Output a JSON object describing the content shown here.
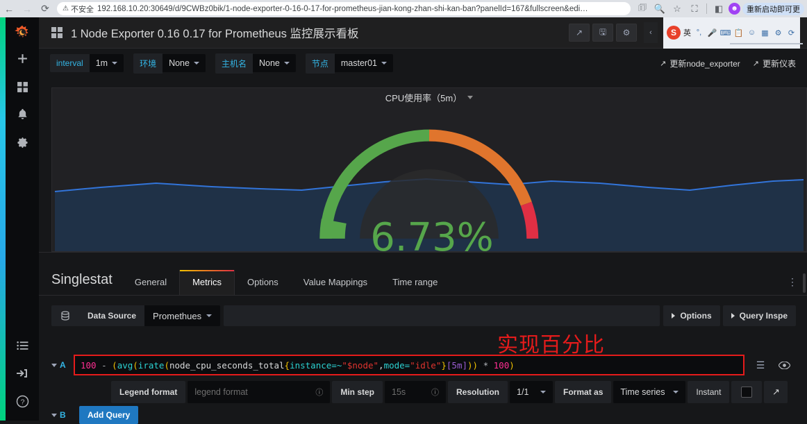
{
  "browser": {
    "back_icon": "←",
    "forward_icon": "→",
    "reload_icon": "⟳",
    "security_label": "不安全",
    "warning_icon": "⚠",
    "url": "192.168.10.20:30649/d/9CWBz0bik/1-node-exporter-0-16-0-17-for-prometheus-jian-kong-zhan-shi-kan-ban?panelId=167&fullscreen&edi…",
    "toolbar_icons": [
      "translate-icon",
      "zoom-icon",
      "bookmark-star-icon",
      "extensions-icon",
      "split-view-icon"
    ],
    "profile_initial": "👤",
    "restart_pill": "重新启动即可更"
  },
  "sidenav": {
    "logo": "grafana-logo",
    "items": [
      {
        "name": "create-add",
        "icon": "+"
      },
      {
        "name": "dashboards",
        "icon": "▦"
      },
      {
        "name": "alerting-bell",
        "icon": "🔔"
      },
      {
        "name": "configuration-gear",
        "icon": "⚙"
      }
    ],
    "bottom_items": [
      {
        "name": "playlist-list",
        "icon": "☰"
      },
      {
        "name": "sign-in",
        "icon": "→]"
      },
      {
        "name": "help",
        "icon": "?"
      }
    ]
  },
  "topnav": {
    "dashboard_title": "1 Node Exporter 0.16 0.17 for Prometheus 监控展示看板",
    "buttons": [
      {
        "name": "share-button",
        "icon": "↗"
      },
      {
        "name": "save-button",
        "icon": "🖫"
      },
      {
        "name": "settings-button",
        "icon": "⚙"
      }
    ],
    "collapse_icon": "‹",
    "extension": {
      "badge": "S",
      "label": "英",
      "icons": [
        "mic-icon",
        "keyboard-icon",
        "clipboard-icon",
        "emoji-icon",
        "apps-icon",
        "settings-icon",
        "refresh-icon"
      ]
    }
  },
  "variables": [
    {
      "name": "interval",
      "label": "interval",
      "value": "1m"
    },
    {
      "name": "environment",
      "label": "环境",
      "value": "None"
    },
    {
      "name": "hostname",
      "label": "主机名",
      "value": "None"
    },
    {
      "name": "node",
      "label": "节点",
      "value": "master01"
    }
  ],
  "variable_links": [
    {
      "name": "update-node-exporter",
      "label": "更新node_exporter"
    },
    {
      "name": "update-dashboard",
      "label": "更新仪表"
    }
  ],
  "panel": {
    "title": "CPU使用率（5m）",
    "value": "6.73%",
    "gauge": {
      "value_color": "#56a64b",
      "thresholds": [
        {
          "color": "#56a64b",
          "from": 0,
          "to": 50
        },
        {
          "color": "#e0752d",
          "from": 50,
          "to": 80
        },
        {
          "color": "#e02f44",
          "from": 80,
          "to": 100
        }
      ],
      "percent": 6.73
    },
    "sparkline_color": "#3274d9"
  },
  "editor": {
    "heading": "Singlestat",
    "tabs": [
      {
        "name": "tab-general",
        "label": "General",
        "active": false
      },
      {
        "name": "tab-metrics",
        "label": "Metrics",
        "active": true
      },
      {
        "name": "tab-options",
        "label": "Options",
        "active": false
      },
      {
        "name": "tab-value-mappings",
        "label": "Value Mappings",
        "active": false
      },
      {
        "name": "tab-time-range",
        "label": "Time range",
        "active": false
      }
    ],
    "kebab_icon": "⋮",
    "datasource": {
      "icon": "🗄",
      "label": "Data Source",
      "value": "Promethues"
    },
    "right_buttons": [
      {
        "name": "options-button",
        "label": "Options"
      },
      {
        "name": "query-inspector-button",
        "label": "Query Inspe"
      }
    ],
    "annotation": "实现百分比",
    "query": {
      "ref_id": "A",
      "expr_tokens": [
        {
          "t": "100",
          "c": "t-num"
        },
        {
          "t": " - ",
          "c": "t-op"
        },
        {
          "t": "(",
          "c": "t-paren"
        },
        {
          "t": "avg",
          "c": "t-func"
        },
        {
          "t": "(",
          "c": "t-paren"
        },
        {
          "t": "irate",
          "c": "t-func"
        },
        {
          "t": "(",
          "c": "t-paren"
        },
        {
          "t": "node_cpu_seconds_total",
          "c": "t-metric"
        },
        {
          "t": "{",
          "c": "t-brace"
        },
        {
          "t": "instance=~",
          "c": "t-label"
        },
        {
          "t": "\"$node\"",
          "c": "t-str"
        },
        {
          "t": ",",
          "c": "t-comma"
        },
        {
          "t": "mode=",
          "c": "t-label"
        },
        {
          "t": "\"idle\"",
          "c": "t-str"
        },
        {
          "t": "}",
          "c": "t-brace"
        },
        {
          "t": "[5m]",
          "c": "t-dur"
        },
        {
          "t": "))",
          "c": "t-paren"
        },
        {
          "t": " * ",
          "c": "t-mul"
        },
        {
          "t": "100",
          "c": "t-num"
        },
        {
          "t": ")",
          "c": "t-paren"
        }
      ],
      "expr_plain": "100 - (avg(irate(node_cpu_seconds_total{instance=~\"$node\",mode=\"idle\"}[5m])) * 100)",
      "row_icons": [
        {
          "name": "query-menu-icon",
          "icon": "☰"
        },
        {
          "name": "query-eye-icon",
          "icon": "👁"
        }
      ]
    },
    "options_row": {
      "legend_format_label": "Legend format",
      "legend_format_placeholder": "legend format",
      "min_step_label": "Min step",
      "min_step_placeholder": "15s",
      "resolution_label": "Resolution",
      "resolution_value": "1/1",
      "format_as_label": "Format as",
      "format_as_value": "Time series",
      "instant_label": "Instant",
      "instant_checked": false,
      "external_link_icon": "↗",
      "info_icon": "i"
    },
    "query_b": {
      "ref_id": "B",
      "add_query_label": "Add Query"
    }
  },
  "colors": {
    "accent_blue": "#33b5e5",
    "green": "#56a64b",
    "orange": "#e0752d",
    "red": "#e02f44",
    "annotation_red": "#e51b1b",
    "panel_bg": "#212124",
    "app_bg": "#161719"
  }
}
